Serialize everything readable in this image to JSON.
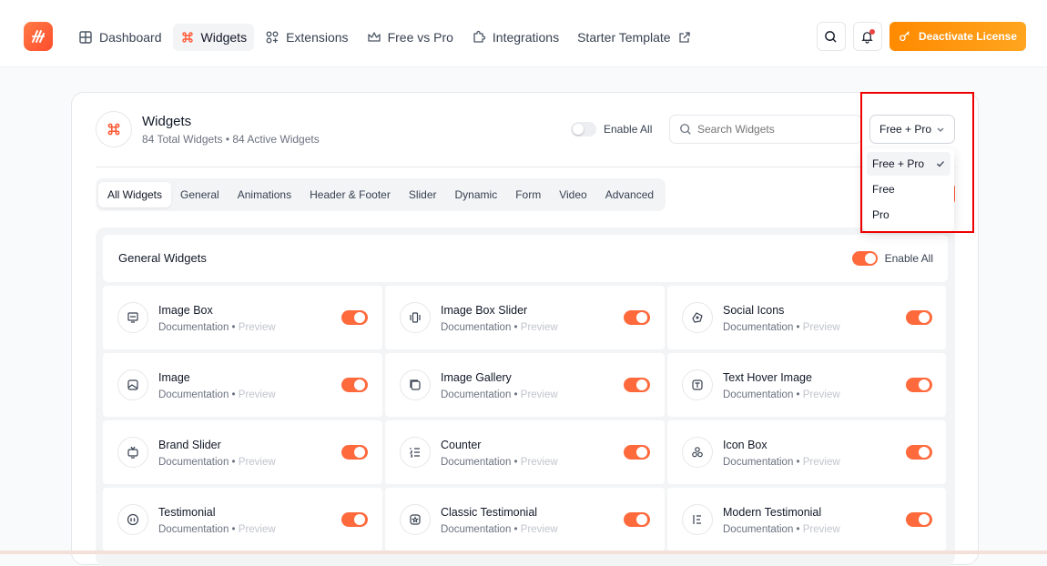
{
  "nav": {
    "items": [
      {
        "label": "Dashboard",
        "icon": "grid-icon",
        "active": false
      },
      {
        "label": "Widgets",
        "icon": "command-icon",
        "active": true
      },
      {
        "label": "Extensions",
        "icon": "extensions-icon",
        "active": false
      },
      {
        "label": "Free vs Pro",
        "icon": "crown-icon",
        "active": false
      },
      {
        "label": "Integrations",
        "icon": "puzzle-icon",
        "active": false
      },
      {
        "label": "Starter Template",
        "icon": "external-link-icon",
        "active": false
      }
    ],
    "deactivate_label": "Deactivate License"
  },
  "colors": {
    "accent": "#ff6a3d",
    "deactivate": "#ff8a00",
    "highlight_box": "#e00000"
  },
  "header": {
    "title": "Widgets",
    "subtitle": "84 Total Widgets • 84 Active Widgets",
    "enable_all_label": "Enable All",
    "search_placeholder": "Search Widgets",
    "filter_value": "Free + Pro"
  },
  "tabs": [
    "All Widgets",
    "General",
    "Animations",
    "Header & Footer",
    "Slider",
    "Dynamic",
    "Form",
    "Video",
    "Advanced"
  ],
  "section": {
    "title": "General Widgets",
    "enable_all_label": "Enable All"
  },
  "widgets": [
    {
      "name": "Image Box",
      "icon": "monitor-icon"
    },
    {
      "name": "Image Box Slider",
      "icon": "slider-icon"
    },
    {
      "name": "Social Icons",
      "icon": "social-icon"
    },
    {
      "name": "Image",
      "icon": "image-icon"
    },
    {
      "name": "Image Gallery",
      "icon": "gallery-icon"
    },
    {
      "name": "Text Hover Image",
      "icon": "text-icon"
    },
    {
      "name": "Brand Slider",
      "icon": "tv-icon"
    },
    {
      "name": "Counter",
      "icon": "list-ordered-icon"
    },
    {
      "name": "Icon Box",
      "icon": "shapes-icon"
    },
    {
      "name": "Testimonial",
      "icon": "quote-icon"
    },
    {
      "name": "Classic Testimonial",
      "icon": "badge-icon"
    },
    {
      "name": "Modern Testimonial",
      "icon": "align-icon"
    }
  ],
  "widget_links": {
    "documentation": "Documentation",
    "separator": " • ",
    "preview": "Preview"
  },
  "dropdown": {
    "options": [
      "Free + Pro",
      "Free",
      "Pro"
    ],
    "selected": "Free + Pro"
  }
}
